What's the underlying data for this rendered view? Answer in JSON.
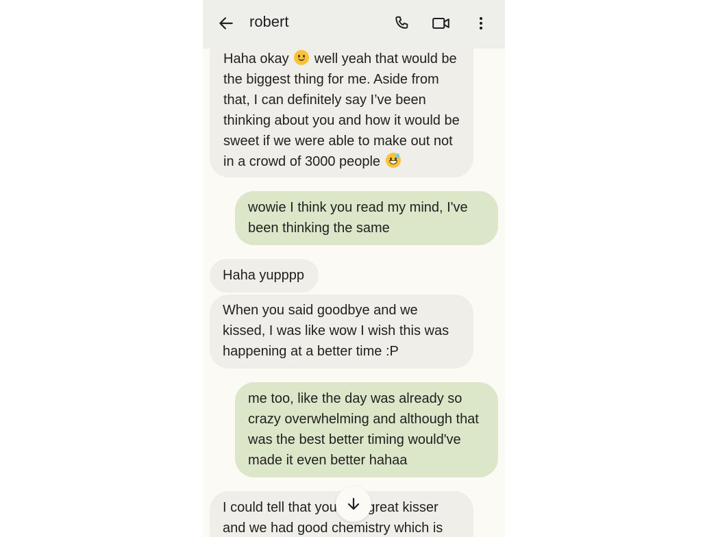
{
  "header": {
    "contact_name": "robert",
    "icons": {
      "back": "back-arrow-icon",
      "call": "phone-icon",
      "video": "video-camera-icon",
      "menu": "more-vertical-icon"
    }
  },
  "messages": [
    {
      "direction": "incoming",
      "parts": {
        "a": "Haha okay",
        "emoji1": "smiling-face",
        "b": "well yeah that would be the biggest thing for me. Aside from that, I can definitely say I’ve been thinking about you and how it would be sweet if we were able to make out not in a crowd of 3000 people",
        "emoji2": "grinning-sweat-face"
      }
    },
    {
      "direction": "outgoing",
      "text": "wowie I think you read my mind, I've been thinking the same"
    },
    {
      "direction": "incoming",
      "text": "Haha yupppp"
    },
    {
      "direction": "incoming",
      "text": "When you said goodbye and we kissed, I was like wow I wish this was happening at a better time :P"
    },
    {
      "direction": "outgoing",
      "text": "me too, like the day was already so crazy overwhelming and although that was the best better timing would've made it even better hahaa"
    },
    {
      "direction": "incoming",
      "text": "I could tell that you’re a great kisser and we had good chemistry which is"
    }
  ],
  "scroll_button": {
    "icon": "arrow-down-icon"
  },
  "colors": {
    "incoming_bubble": "#efeee8",
    "outgoing_bubble": "#dce6c8",
    "background": "#fbfaf5",
    "header": "#eeeeea"
  }
}
